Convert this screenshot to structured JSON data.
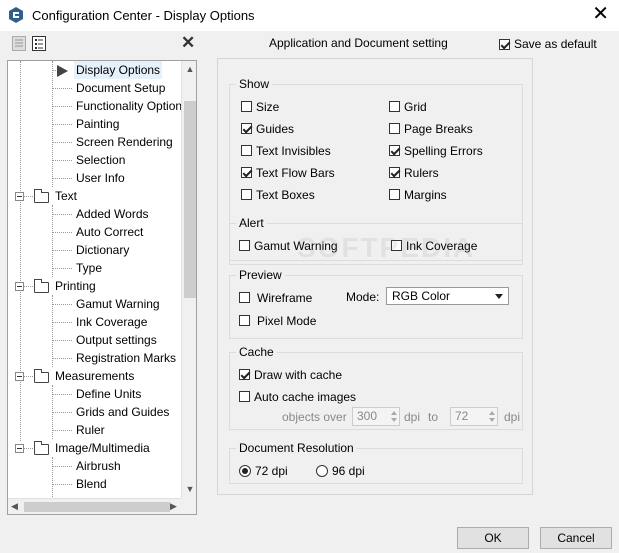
{
  "window": {
    "title": "Configuration Center - Display Options",
    "close_glyph": "✕"
  },
  "header": {
    "title": "Application and Document setting",
    "save_default_label": "Save as default",
    "save_default_checked": true,
    "close_glyph": "✕"
  },
  "icons": {
    "toolbar_left": "list-view-icon",
    "toolbar_right": "details-view-icon"
  },
  "tree": {
    "items": [
      {
        "label": "Display Options",
        "level": 2,
        "selected": true
      },
      {
        "label": "Document Setup",
        "level": 2
      },
      {
        "label": "Functionality Options",
        "level": 2
      },
      {
        "label": "Painting",
        "level": 2
      },
      {
        "label": "Screen Rendering",
        "level": 2
      },
      {
        "label": "Selection",
        "level": 2
      },
      {
        "label": "User Info",
        "level": 2
      },
      {
        "label": "Text",
        "level": 1
      },
      {
        "label": "Added Words",
        "level": 2
      },
      {
        "label": "Auto Correct",
        "level": 2
      },
      {
        "label": "Dictionary",
        "level": 2
      },
      {
        "label": "Type",
        "level": 2
      },
      {
        "label": "Printing",
        "level": 1
      },
      {
        "label": "Gamut Warning",
        "level": 2
      },
      {
        "label": "Ink Coverage",
        "level": 2
      },
      {
        "label": "Output settings",
        "level": 2
      },
      {
        "label": "Registration Marks",
        "level": 2
      },
      {
        "label": "Measurements",
        "level": 1
      },
      {
        "label": "Define Units",
        "level": 2
      },
      {
        "label": "Grids and Guides",
        "level": 2
      },
      {
        "label": "Ruler",
        "level": 2
      },
      {
        "label": "Image/Multimedia",
        "level": 1
      },
      {
        "label": "Airbrush",
        "level": 2
      },
      {
        "label": "Blend",
        "level": 2
      }
    ]
  },
  "show": {
    "title": "Show",
    "left": [
      {
        "label": "Size",
        "checked": false
      },
      {
        "label": "Guides",
        "checked": true
      },
      {
        "label": "Text Invisibles",
        "checked": false
      },
      {
        "label": "Text Flow Bars",
        "checked": true
      },
      {
        "label": "Text Boxes",
        "checked": false
      }
    ],
    "right": [
      {
        "label": "Grid",
        "checked": false
      },
      {
        "label": "Page Breaks",
        "checked": false
      },
      {
        "label": "Spelling Errors",
        "checked": true
      },
      {
        "label": "Rulers",
        "checked": true
      },
      {
        "label": "Margins",
        "checked": false
      }
    ]
  },
  "alert": {
    "title": "Alert",
    "gamut": {
      "label": "Gamut Warning",
      "checked": false
    },
    "ink": {
      "label": "Ink Coverage",
      "checked": false
    }
  },
  "preview": {
    "title": "Preview",
    "wireframe": {
      "label": "Wireframe",
      "checked": false
    },
    "pixel": {
      "label": "Pixel Mode",
      "checked": false
    },
    "mode_label": "Mode:",
    "mode_value": "RGB Color"
  },
  "cache": {
    "title": "Cache",
    "draw": {
      "label": "Draw with cache",
      "checked": true
    },
    "auto": {
      "label": "Auto cache images",
      "checked": false
    },
    "objects_over": "objects over",
    "dpi_from": "300",
    "dpi_label": "dpi",
    "to_label": "to",
    "dpi_to": "72"
  },
  "resolution": {
    "title": "Document Resolution",
    "opt72": {
      "label": "72 dpi",
      "checked": true
    },
    "opt96": {
      "label": "96 dpi",
      "checked": false
    }
  },
  "buttons": {
    "ok": "OK",
    "cancel": "Cancel"
  },
  "watermark": "SOFTPEDIA"
}
